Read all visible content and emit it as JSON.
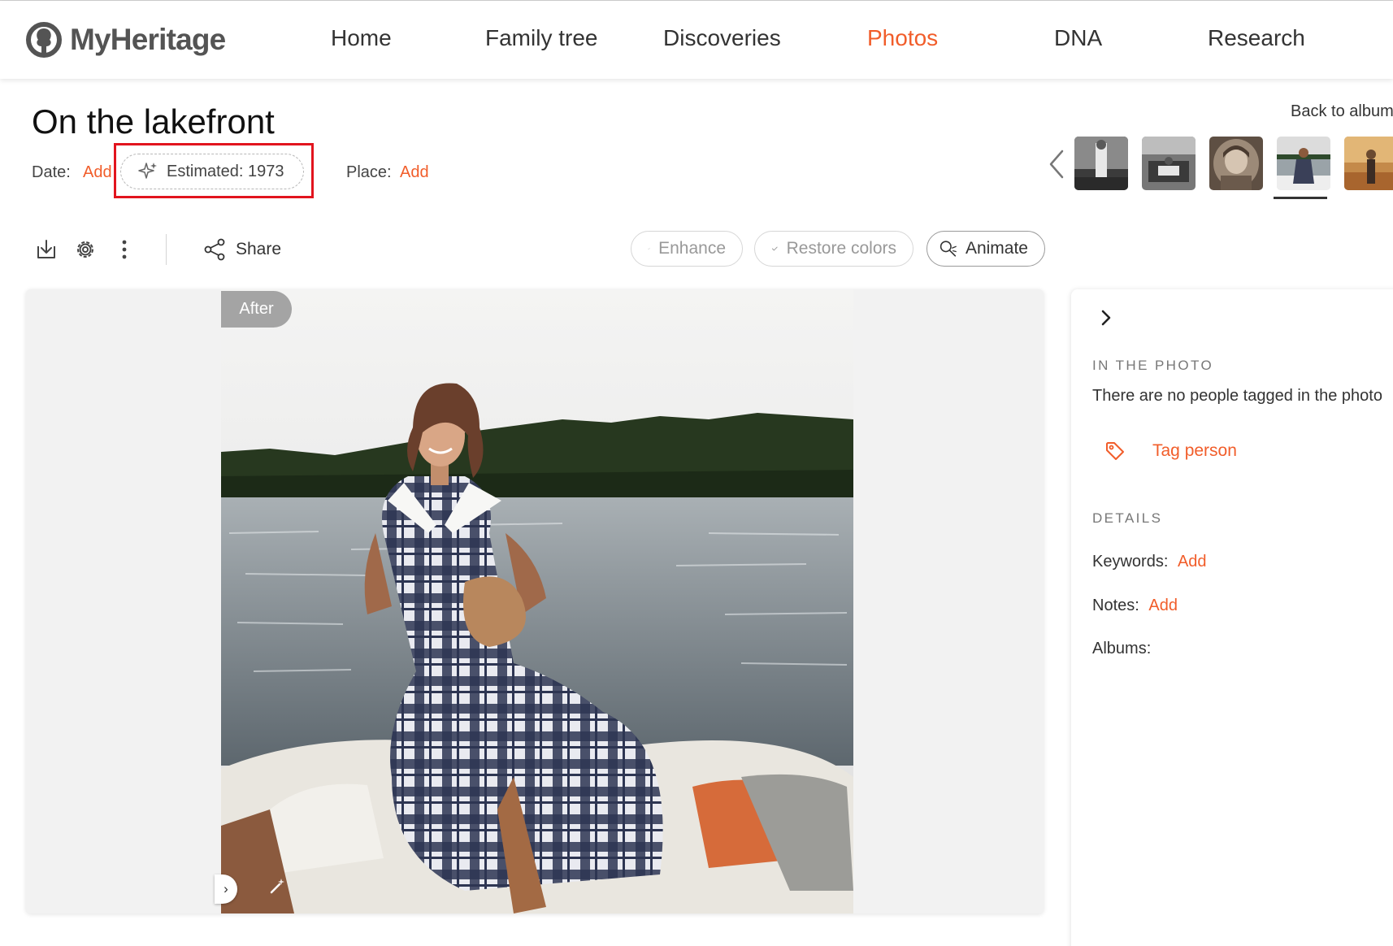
{
  "brand": {
    "name": "MyHeritage",
    "accent_color": "#f15d2a",
    "logo_icon": "myheritage-logo-icon"
  },
  "nav": {
    "items": [
      {
        "label": "Home",
        "active": false
      },
      {
        "label": "Family tree",
        "active": false
      },
      {
        "label": "Discoveries",
        "active": false
      },
      {
        "label": "Photos",
        "active": true
      },
      {
        "label": "DNA",
        "active": false
      },
      {
        "label": "Research",
        "active": false
      }
    ]
  },
  "photo_header": {
    "title": "On the lakefront",
    "date_label": "Date:",
    "date_add": "Add",
    "estimated": "Estimated: 1973",
    "place_label": "Place:",
    "place_add": "Add",
    "back_link": "Back to album",
    "highlight_color": "#e2141e"
  },
  "thumbnails": {
    "prev_icon": "chevron-left-icon",
    "items": [
      {
        "name": "thumbnail-1",
        "selected": false
      },
      {
        "name": "thumbnail-2",
        "selected": false
      },
      {
        "name": "thumbnail-3",
        "selected": false
      },
      {
        "name": "thumbnail-4",
        "selected": true
      },
      {
        "name": "thumbnail-5",
        "selected": false
      }
    ]
  },
  "toolbar": {
    "icons": [
      "download-icon",
      "gear-icon",
      "more-vertical-icon"
    ],
    "share_label": "Share",
    "enhance_label": "Enhance",
    "restore_label": "Restore colors",
    "animate_label": "Animate"
  },
  "viewer": {
    "badge": "After"
  },
  "sidebar": {
    "in_photo_title": "IN THE PHOTO",
    "no_people_text": "There are no people tagged in the photo",
    "tag_person": "Tag person",
    "details_title": "DETAILS",
    "keywords_label": "Keywords:",
    "keywords_add": "Add",
    "notes_label": "Notes:",
    "notes_add": "Add",
    "albums_label": "Albums:"
  }
}
